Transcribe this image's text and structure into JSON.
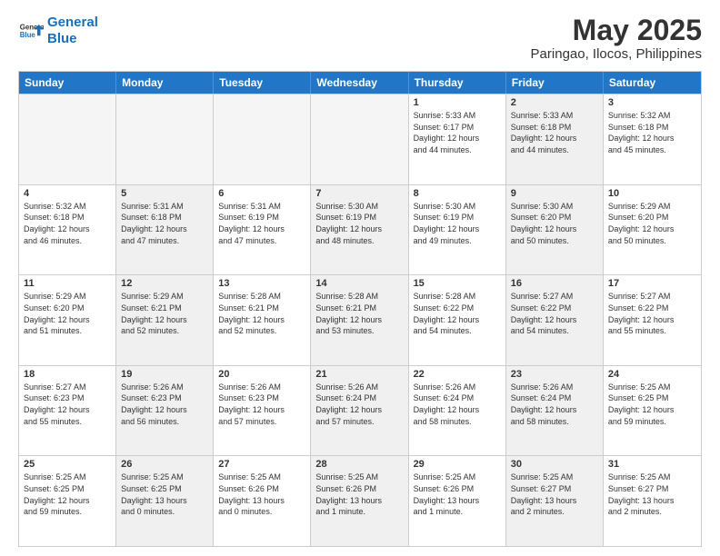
{
  "logo": {
    "line1": "General",
    "line2": "Blue"
  },
  "header": {
    "month": "May 2025",
    "location": "Paringao, Ilocos, Philippines"
  },
  "weekdays": [
    "Sunday",
    "Monday",
    "Tuesday",
    "Wednesday",
    "Thursday",
    "Friday",
    "Saturday"
  ],
  "rows": [
    {
      "cells": [
        {
          "day": "",
          "empty": true
        },
        {
          "day": "",
          "empty": true
        },
        {
          "day": "",
          "empty": true
        },
        {
          "day": "",
          "empty": true
        },
        {
          "day": "1",
          "lines": [
            "Sunrise: 5:33 AM",
            "Sunset: 6:17 PM",
            "Daylight: 12 hours",
            "and 44 minutes."
          ]
        },
        {
          "day": "2",
          "lines": [
            "Sunrise: 5:33 AM",
            "Sunset: 6:18 PM",
            "Daylight: 12 hours",
            "and 44 minutes."
          ],
          "shaded": true
        },
        {
          "day": "3",
          "lines": [
            "Sunrise: 5:32 AM",
            "Sunset: 6:18 PM",
            "Daylight: 12 hours",
            "and 45 minutes."
          ]
        }
      ]
    },
    {
      "cells": [
        {
          "day": "4",
          "lines": [
            "Sunrise: 5:32 AM",
            "Sunset: 6:18 PM",
            "Daylight: 12 hours",
            "and 46 minutes."
          ]
        },
        {
          "day": "5",
          "lines": [
            "Sunrise: 5:31 AM",
            "Sunset: 6:18 PM",
            "Daylight: 12 hours",
            "and 47 minutes."
          ],
          "shaded": true
        },
        {
          "day": "6",
          "lines": [
            "Sunrise: 5:31 AM",
            "Sunset: 6:19 PM",
            "Daylight: 12 hours",
            "and 47 minutes."
          ]
        },
        {
          "day": "7",
          "lines": [
            "Sunrise: 5:30 AM",
            "Sunset: 6:19 PM",
            "Daylight: 12 hours",
            "and 48 minutes."
          ],
          "shaded": true
        },
        {
          "day": "8",
          "lines": [
            "Sunrise: 5:30 AM",
            "Sunset: 6:19 PM",
            "Daylight: 12 hours",
            "and 49 minutes."
          ]
        },
        {
          "day": "9",
          "lines": [
            "Sunrise: 5:30 AM",
            "Sunset: 6:20 PM",
            "Daylight: 12 hours",
            "and 50 minutes."
          ],
          "shaded": true
        },
        {
          "day": "10",
          "lines": [
            "Sunrise: 5:29 AM",
            "Sunset: 6:20 PM",
            "Daylight: 12 hours",
            "and 50 minutes."
          ]
        }
      ]
    },
    {
      "cells": [
        {
          "day": "11",
          "lines": [
            "Sunrise: 5:29 AM",
            "Sunset: 6:20 PM",
            "Daylight: 12 hours",
            "and 51 minutes."
          ]
        },
        {
          "day": "12",
          "lines": [
            "Sunrise: 5:29 AM",
            "Sunset: 6:21 PM",
            "Daylight: 12 hours",
            "and 52 minutes."
          ],
          "shaded": true
        },
        {
          "day": "13",
          "lines": [
            "Sunrise: 5:28 AM",
            "Sunset: 6:21 PM",
            "Daylight: 12 hours",
            "and 52 minutes."
          ]
        },
        {
          "day": "14",
          "lines": [
            "Sunrise: 5:28 AM",
            "Sunset: 6:21 PM",
            "Daylight: 12 hours",
            "and 53 minutes."
          ],
          "shaded": true
        },
        {
          "day": "15",
          "lines": [
            "Sunrise: 5:28 AM",
            "Sunset: 6:22 PM",
            "Daylight: 12 hours",
            "and 54 minutes."
          ]
        },
        {
          "day": "16",
          "lines": [
            "Sunrise: 5:27 AM",
            "Sunset: 6:22 PM",
            "Daylight: 12 hours",
            "and 54 minutes."
          ],
          "shaded": true
        },
        {
          "day": "17",
          "lines": [
            "Sunrise: 5:27 AM",
            "Sunset: 6:22 PM",
            "Daylight: 12 hours",
            "and 55 minutes."
          ]
        }
      ]
    },
    {
      "cells": [
        {
          "day": "18",
          "lines": [
            "Sunrise: 5:27 AM",
            "Sunset: 6:23 PM",
            "Daylight: 12 hours",
            "and 55 minutes."
          ]
        },
        {
          "day": "19",
          "lines": [
            "Sunrise: 5:26 AM",
            "Sunset: 6:23 PM",
            "Daylight: 12 hours",
            "and 56 minutes."
          ],
          "shaded": true
        },
        {
          "day": "20",
          "lines": [
            "Sunrise: 5:26 AM",
            "Sunset: 6:23 PM",
            "Daylight: 12 hours",
            "and 57 minutes."
          ]
        },
        {
          "day": "21",
          "lines": [
            "Sunrise: 5:26 AM",
            "Sunset: 6:24 PM",
            "Daylight: 12 hours",
            "and 57 minutes."
          ],
          "shaded": true
        },
        {
          "day": "22",
          "lines": [
            "Sunrise: 5:26 AM",
            "Sunset: 6:24 PM",
            "Daylight: 12 hours",
            "and 58 minutes."
          ]
        },
        {
          "day": "23",
          "lines": [
            "Sunrise: 5:26 AM",
            "Sunset: 6:24 PM",
            "Daylight: 12 hours",
            "and 58 minutes."
          ],
          "shaded": true
        },
        {
          "day": "24",
          "lines": [
            "Sunrise: 5:25 AM",
            "Sunset: 6:25 PM",
            "Daylight: 12 hours",
            "and 59 minutes."
          ]
        }
      ]
    },
    {
      "cells": [
        {
          "day": "25",
          "lines": [
            "Sunrise: 5:25 AM",
            "Sunset: 6:25 PM",
            "Daylight: 12 hours",
            "and 59 minutes."
          ]
        },
        {
          "day": "26",
          "lines": [
            "Sunrise: 5:25 AM",
            "Sunset: 6:25 PM",
            "Daylight: 13 hours",
            "and 0 minutes."
          ],
          "shaded": true
        },
        {
          "day": "27",
          "lines": [
            "Sunrise: 5:25 AM",
            "Sunset: 6:26 PM",
            "Daylight: 13 hours",
            "and 0 minutes."
          ]
        },
        {
          "day": "28",
          "lines": [
            "Sunrise: 5:25 AM",
            "Sunset: 6:26 PM",
            "Daylight: 13 hours",
            "and 1 minute."
          ],
          "shaded": true
        },
        {
          "day": "29",
          "lines": [
            "Sunrise: 5:25 AM",
            "Sunset: 6:26 PM",
            "Daylight: 13 hours",
            "and 1 minute."
          ]
        },
        {
          "day": "30",
          "lines": [
            "Sunrise: 5:25 AM",
            "Sunset: 6:27 PM",
            "Daylight: 13 hours",
            "and 2 minutes."
          ],
          "shaded": true
        },
        {
          "day": "31",
          "lines": [
            "Sunrise: 5:25 AM",
            "Sunset: 6:27 PM",
            "Daylight: 13 hours",
            "and 2 minutes."
          ]
        }
      ]
    }
  ]
}
